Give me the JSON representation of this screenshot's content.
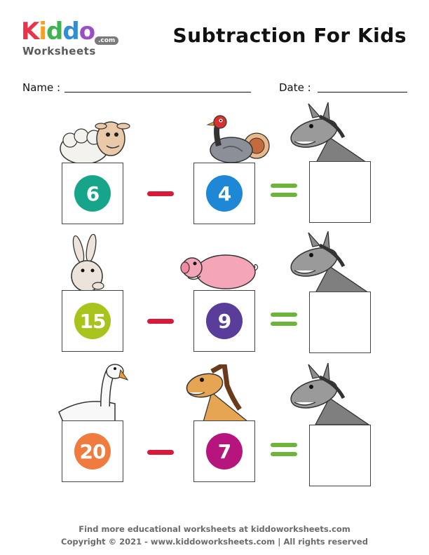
{
  "logo": {
    "kiddo_letters": [
      "K",
      "i",
      "d",
      "d",
      "o"
    ],
    "kiddo_colors": [
      "#e8334a",
      "#f7a11a",
      "#3fb34f",
      "#2f8fd6",
      "#9b4fc7"
    ],
    "worksheets": "Worksheets",
    "com": ".com"
  },
  "title": "Subtraction For Kids",
  "fields": {
    "name_label": "Name :",
    "date_label": "Date :"
  },
  "problems": [
    {
      "a": "6",
      "a_color": "#16a58a",
      "b": "4",
      "b_color": "#1e87d6"
    },
    {
      "a": "15",
      "a_color": "#a7c31c",
      "b": "9",
      "b_color": "#5a3c9a"
    },
    {
      "a": "20",
      "a_color": "#ef7b3e",
      "b": "7",
      "b_color": "#b5157c"
    }
  ],
  "footer": {
    "line1": "Find more educational worksheets at kiddoworksheets.com",
    "line2": "Copyright © 2021 - www.kiddoworksheets.com  |  All rights reserved"
  }
}
